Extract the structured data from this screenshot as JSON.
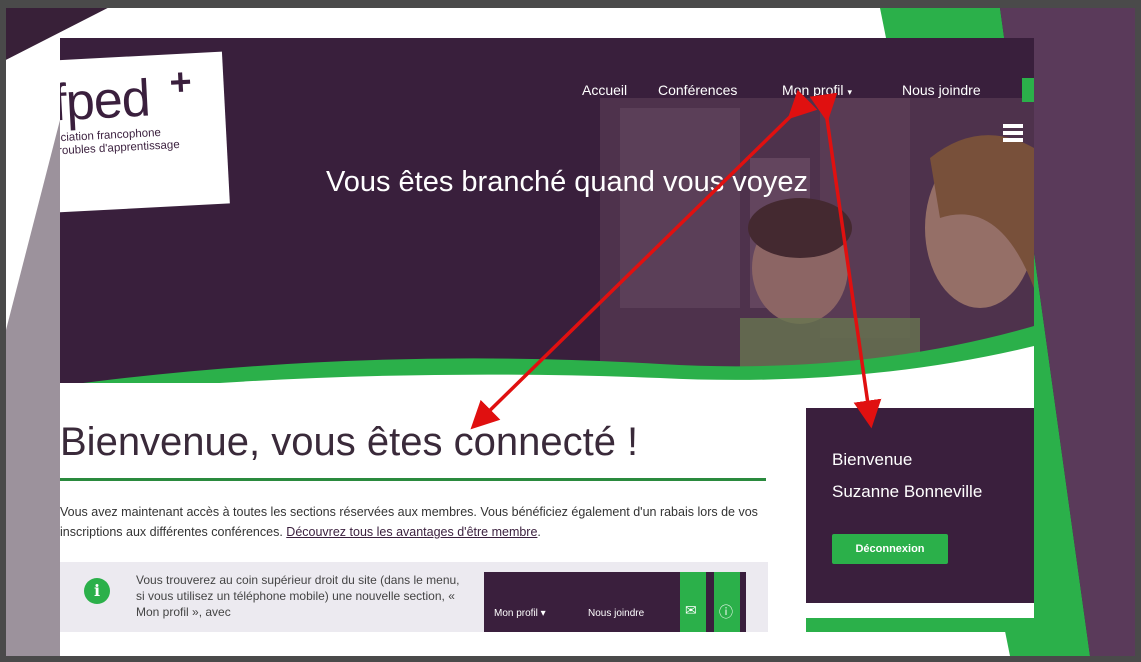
{
  "colors": {
    "brand_purple": "#3a1f3d",
    "accent_green": "#2bb04a",
    "arrow_red": "#e01010"
  },
  "logo": {
    "name": "fped",
    "plus": "+",
    "tagline_line1": "ociation francophone",
    "tagline_line2": "troubles d'apprentissage"
  },
  "nav": {
    "items": [
      {
        "label": "Accueil"
      },
      {
        "label": "Conférences"
      },
      {
        "label": "Mon profil"
      },
      {
        "label": "Nous joindre"
      }
    ],
    "menu_icon": "hamburger-icon",
    "mail_icon": "envelope-icon"
  },
  "hero": {
    "tagline": "Vous êtes branché quand vous voyez"
  },
  "main": {
    "title": "Bienvenue, vous êtes connecté !",
    "intro_text": "Vous avez maintenant accès à toutes les sections réservées aux membres. Vous bénéficiez également d'un rabais lors de vos inscriptions aux différentes conférences. ",
    "intro_link": "Découvrez tous les avantages d'être membre",
    "intro_end": "."
  },
  "info_box": {
    "icon": "info-icon",
    "icon_glyph": "i",
    "text": "Vous trouverez au coin supérieur droit du site (dans le menu, si vous utilisez un téléphone mobile) une nouvelle section, « Mon profil », avec",
    "mini_nav_profile": "Mon profil",
    "mini_nav_contact": "Nous joindre"
  },
  "sidebar": {
    "greeting": "Bienvenue",
    "user_name": "Suzanne Bonneville",
    "logout_label": "Déconnexion"
  }
}
